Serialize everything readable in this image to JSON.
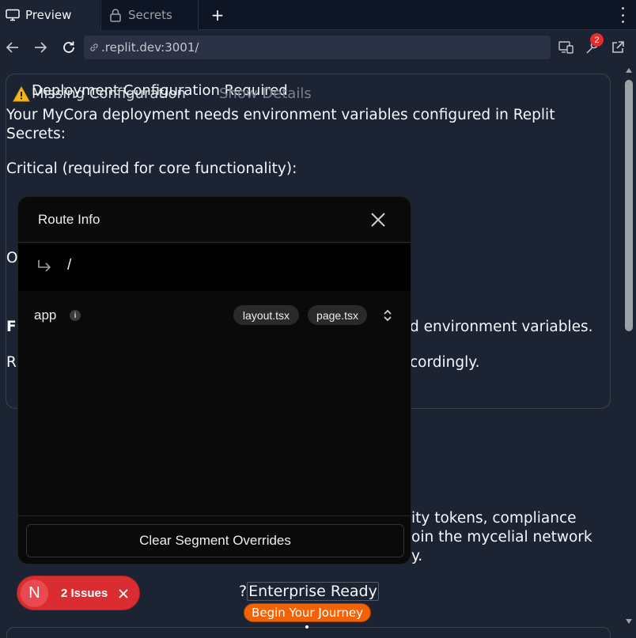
{
  "tabs": {
    "preview_label": "Preview",
    "secrets_label": "Secrets",
    "add_label": "+"
  },
  "nav": {
    "url": ".replit.dev:3001/",
    "badge_count": "2"
  },
  "alert": {
    "title": "Deployment Configuration Required",
    "overlap_subtitle": "Missing Configuration",
    "show_details": "Show Details",
    "intro": "Your MyCora deployment needs environment variables configured in Replit Secrets:",
    "critical": "Critical (required for core functionality):",
    "left_o": "O",
    "left_fi": "Fi",
    "left_r": "R",
    "right_env": "d environment variables.",
    "right_acc": "cordingly."
  },
  "content": {
    "line1": "ity tokens, compliance",
    "line2": "oin the mycelial network",
    "line3": "y.",
    "cta_prefix": "?",
    "cta_boxed": "Enterprise Ready",
    "journey_button": "Begin Your Journey"
  },
  "route_info": {
    "title": "Route Info",
    "path": "/",
    "segment": "app",
    "info_glyph": "i",
    "files": [
      "layout.tsx",
      "page.tsx"
    ],
    "clear_button": "Clear Segment Overrides"
  },
  "issues": {
    "logo_letter": "N",
    "label": "2 Issues"
  },
  "colors": {
    "accent_orange": "#f26207",
    "issues_red": "#d92d32",
    "page_bg": "#1c2333"
  }
}
